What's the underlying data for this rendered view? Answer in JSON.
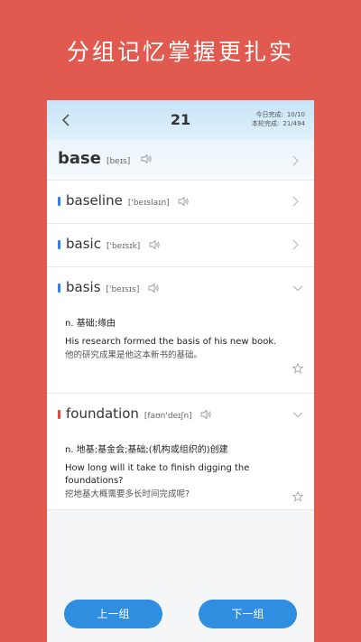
{
  "banner": {
    "title": "分组记忆掌握更扎实"
  },
  "header": {
    "count": "21",
    "stats": [
      {
        "label": "今日完成:",
        "value": "10/10"
      },
      {
        "label": "本轮完成:",
        "value": "21/494"
      }
    ]
  },
  "words": [
    {
      "word": "base",
      "phonetic": "[beɪs]"
    },
    {
      "word": "baseline",
      "phonetic": "['beɪslaɪn]",
      "dot_color": "#2f80ed"
    },
    {
      "word": "basic",
      "phonetic": "['beɪsɪk]",
      "dot_color": "#2f80ed"
    },
    {
      "word": "basis",
      "phonetic": "['beɪsɪs]",
      "dot_color": "#2f80ed",
      "meaning": "n. 基础;缘由",
      "sentence": "His research formed the basis of his new book.",
      "translation": "他的研究成果是他这本新书的基础。"
    },
    {
      "word": "foundation",
      "phonetic": "[faʊn'deɪʃn]",
      "dot_color": "#e04a3f",
      "meaning": "n. 地基;基金会;基础;(机构或组织的)创建",
      "sentence": "How long will it take to finish digging the foundations?",
      "translation": "挖地基大概需要多长时间完成呢?"
    }
  ],
  "buttons": {
    "prev": "上一组",
    "next": "下一组"
  },
  "colors": {
    "background": "#e05a50",
    "primary": "#2f8ee0"
  }
}
